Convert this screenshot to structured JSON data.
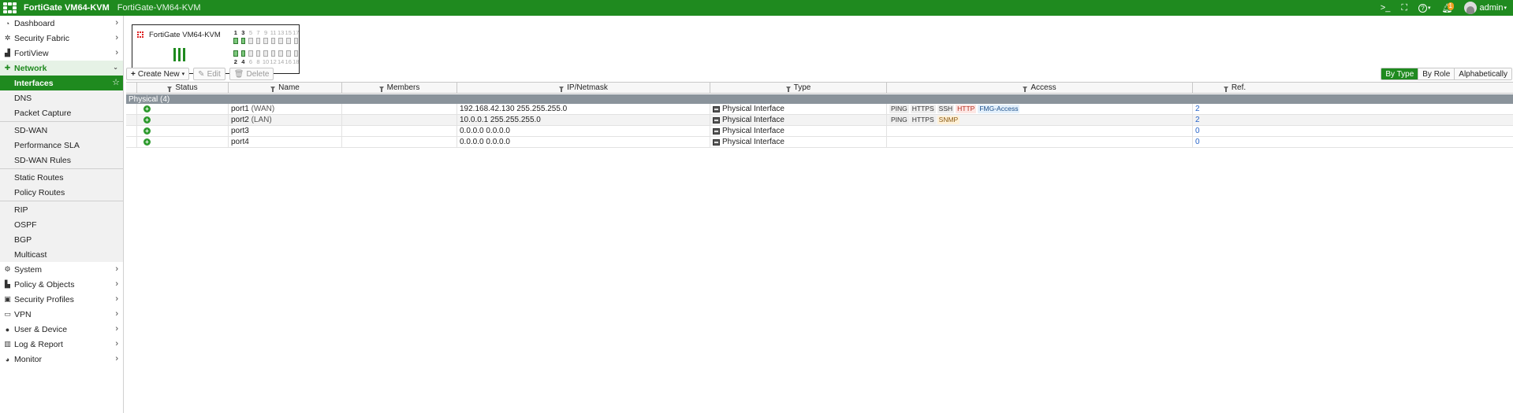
{
  "topbar": {
    "app_title": "FortiGate VM64-KVM",
    "hostname": "FortiGate-VM64-KVM",
    "terminal_label": ">_",
    "help_label": "?",
    "notification_count": "1",
    "user": "admin"
  },
  "sidebar": {
    "items": [
      {
        "label": "Dashboard",
        "icon": "dashboard-icon"
      },
      {
        "label": "Security Fabric",
        "icon": "security-fabric-icon"
      },
      {
        "label": "FortiView",
        "icon": "fortiview-icon"
      },
      {
        "label": "Network",
        "icon": "network-icon"
      }
    ],
    "network_sub": [
      {
        "label": "Interfaces"
      },
      {
        "label": "DNS"
      },
      {
        "label": "Packet Capture"
      },
      {
        "label": "SD-WAN"
      },
      {
        "label": "Performance SLA"
      },
      {
        "label": "SD-WAN Rules"
      },
      {
        "label": "Static Routes"
      },
      {
        "label": "Policy Routes"
      },
      {
        "label": "RIP"
      },
      {
        "label": "OSPF"
      },
      {
        "label": "BGP"
      },
      {
        "label": "Multicast"
      }
    ],
    "bottom_items": [
      {
        "label": "System",
        "icon": "gear-icon"
      },
      {
        "label": "Policy & Objects",
        "icon": "policy-icon"
      },
      {
        "label": "Security Profiles",
        "icon": "lock-icon"
      },
      {
        "label": "VPN",
        "icon": "laptop-icon"
      },
      {
        "label": "User & Device",
        "icon": "user-icon"
      },
      {
        "label": "Log & Report",
        "icon": "chart-icon"
      },
      {
        "label": "Monitor",
        "icon": "monitor-icon"
      }
    ]
  },
  "device": {
    "name": "FortiGate VM64-KVM",
    "top_ports": [
      "1",
      "3",
      "5",
      "7",
      "9",
      "11",
      "13",
      "15",
      "17"
    ],
    "bottom_ports": [
      "2",
      "4",
      "6",
      "8",
      "10",
      "12",
      "14",
      "16",
      "18"
    ]
  },
  "toolbar": {
    "create_label": "Create New",
    "edit_label": "Edit",
    "delete_label": "Delete"
  },
  "view": {
    "by_type": "By Type",
    "by_role": "By Role",
    "alphabetically": "Alphabetically"
  },
  "table": {
    "headers": {
      "status": "Status",
      "name": "Name",
      "members": "Members",
      "ip": "IP/Netmask",
      "type": "Type",
      "access": "Access",
      "ref": "Ref."
    },
    "group_label": "Physical (4)",
    "rows": [
      {
        "name": "port1",
        "role": "(WAN)",
        "ip": "192.168.42.130 255.255.255.0",
        "type": "Physical Interface",
        "access": [
          "PING",
          "HTTPS",
          "SSH",
          "HTTP",
          "FMG-Access"
        ],
        "ref": "2"
      },
      {
        "name": "port2",
        "role": "(LAN)",
        "ip": "10.0.0.1 255.255.255.0",
        "type": "Physical Interface",
        "access": [
          "PING",
          "HTTPS",
          "SNMP"
        ],
        "ref": "2"
      },
      {
        "name": "port3",
        "role": "",
        "ip": "0.0.0.0 0.0.0.0",
        "type": "Physical Interface",
        "access": [],
        "ref": "0"
      },
      {
        "name": "port4",
        "role": "",
        "ip": "0.0.0.0 0.0.0.0",
        "type": "Physical Interface",
        "access": [],
        "ref": "0"
      }
    ]
  },
  "colors": {
    "brand_green": "#1f8a1f",
    "group_row": "#8a939b",
    "link_blue": "#2563c9"
  }
}
